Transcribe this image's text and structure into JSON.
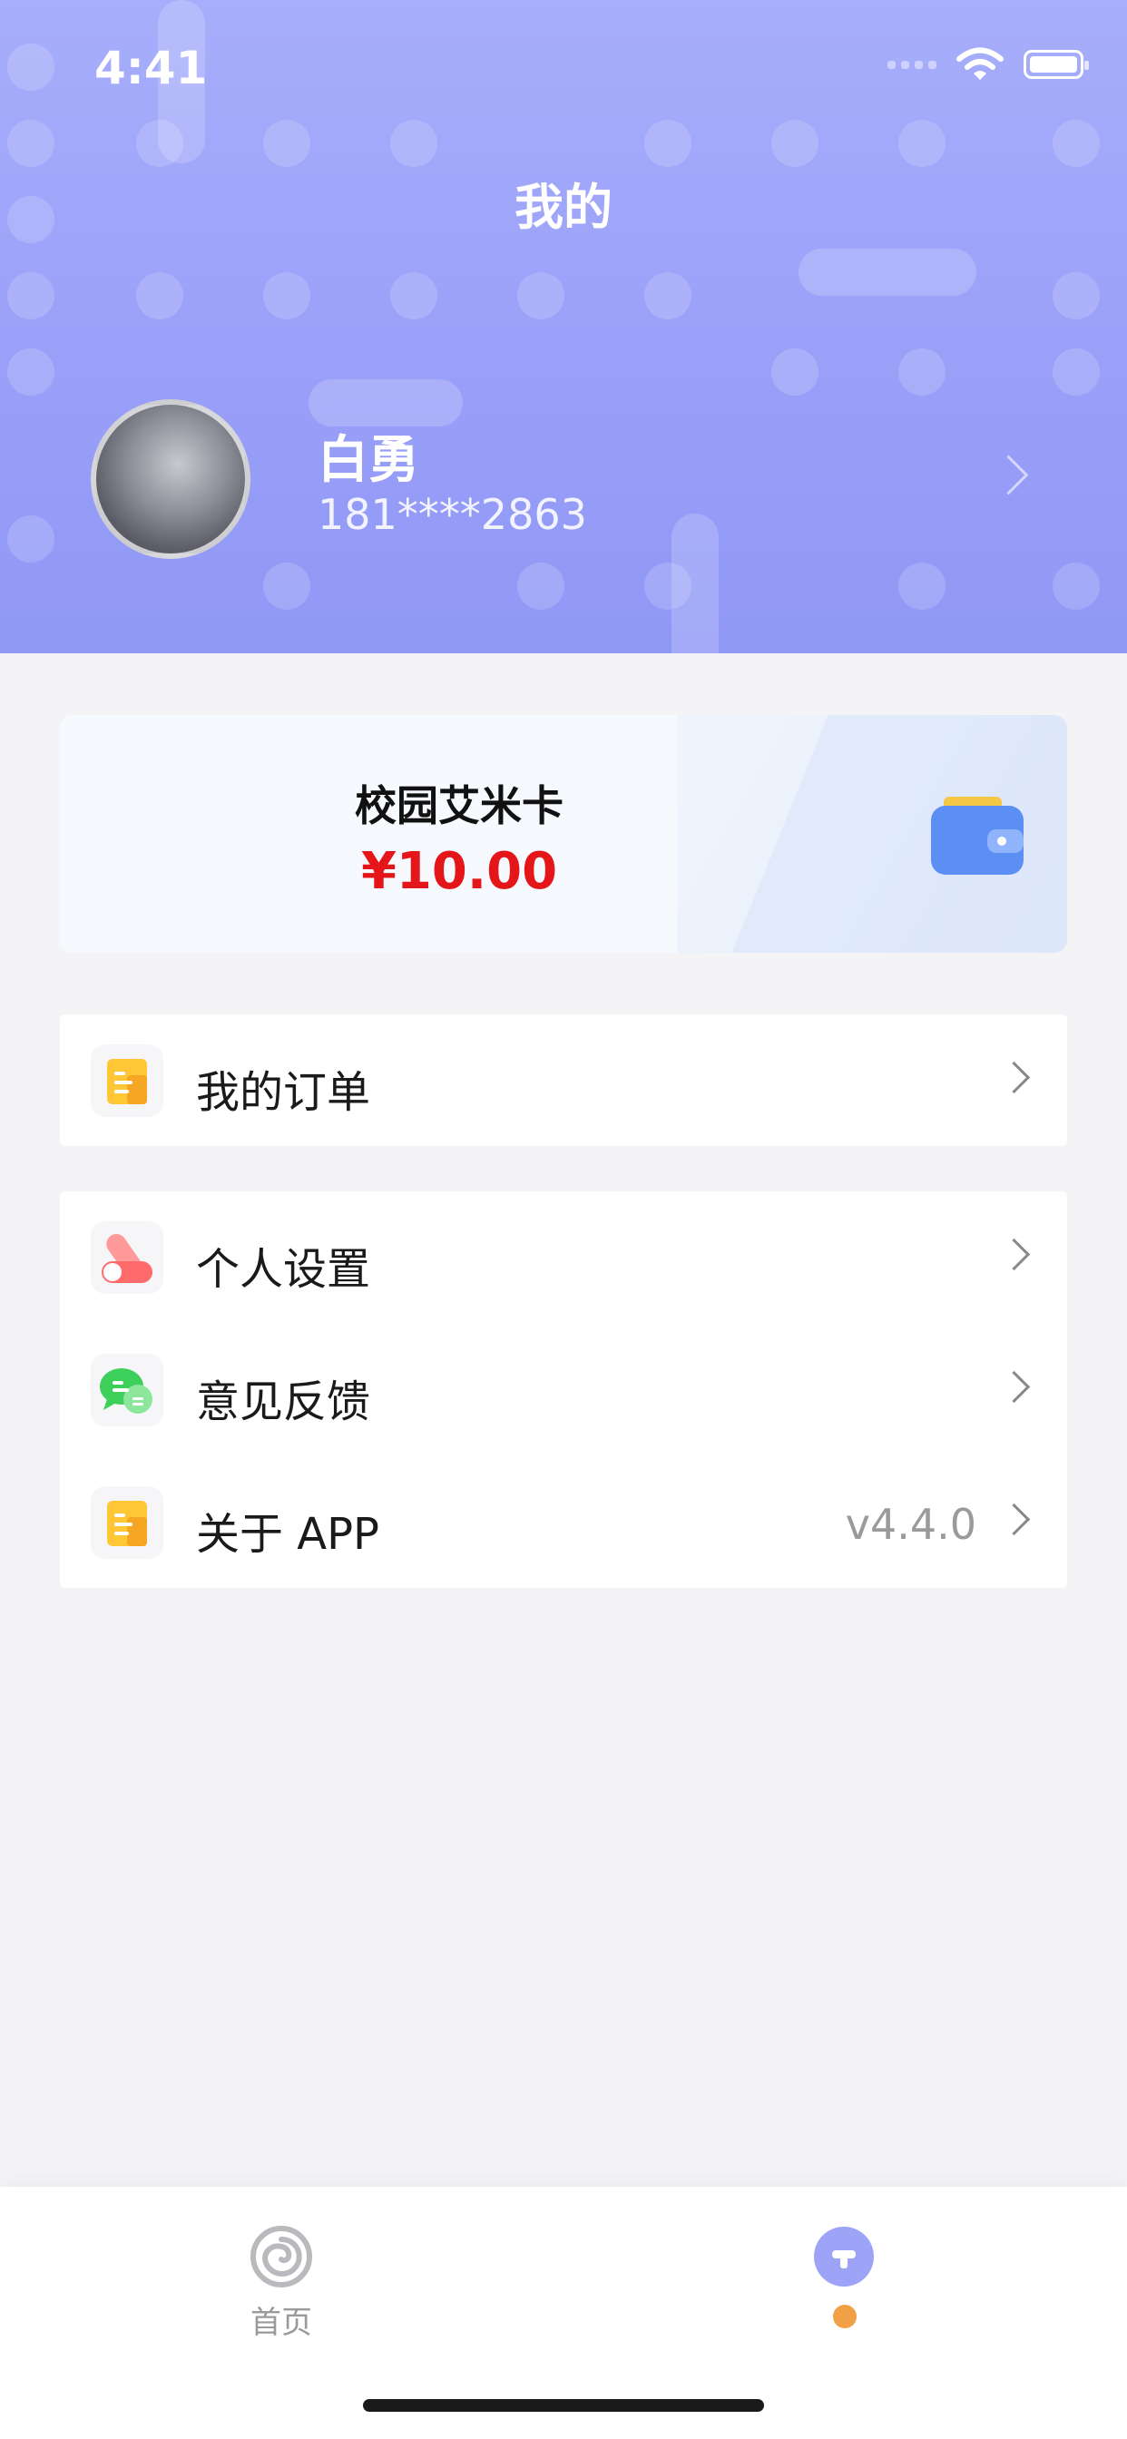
{
  "status_bar": {
    "time": "4:41"
  },
  "header": {
    "title": "我的"
  },
  "profile": {
    "name": "白勇",
    "phone": "181****2863"
  },
  "card": {
    "title": "校园艾米卡",
    "amount": "¥10.00"
  },
  "menu_group_1": [
    {
      "label": "我的订单",
      "icon": "orders-icon"
    }
  ],
  "menu_group_2": [
    {
      "label": "个人设置",
      "icon": "settings-toggle-icon"
    },
    {
      "label": "意见反馈",
      "icon": "feedback-chat-icon"
    },
    {
      "label": "关于 APP",
      "icon": "about-doc-icon",
      "value": "v4.4.0"
    }
  ],
  "tabbar": {
    "home_label": "首页",
    "home_icon": "spiral-home-icon",
    "mine_icon": "mine-icon"
  },
  "colors": {
    "accent": "#9aa0f8",
    "price": "#e4161a",
    "badge": "#f2a045"
  }
}
